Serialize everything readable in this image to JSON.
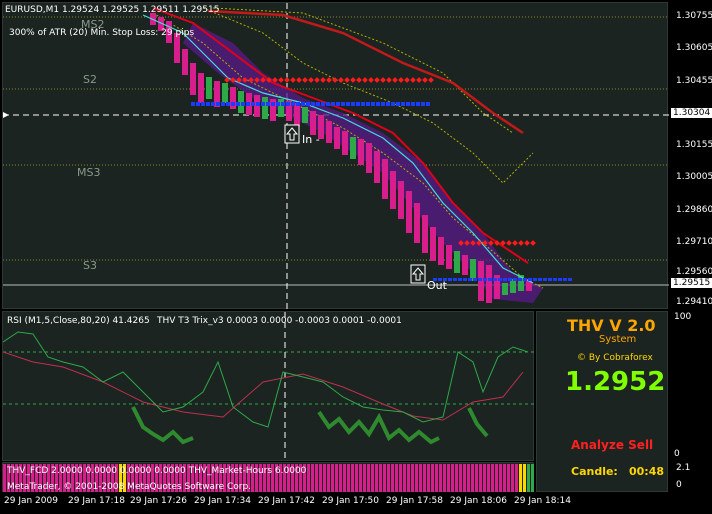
{
  "symbol_header": "EURUSD,M1  1.29524 1.29525 1.29511 1.29515",
  "atr_info": "300% of ATR (20)    Min. Stop Loss:   29 pips",
  "levels": {
    "ms2": "MS2",
    "s2": "S2",
    "ms3": "MS3",
    "s3": "S3"
  },
  "signals": {
    "in": "In -",
    "out": "Out"
  },
  "price_axis": [
    "1.30755",
    "1.30605",
    "1.30455",
    "1.30304",
    "1.30155",
    "1.30005",
    "1.29860",
    "1.29710",
    "1.29560",
    "1.29515",
    "1.29410"
  ],
  "current_price_label": "1.29515",
  "crosshair_price_label": "1.30304",
  "indicator_header": "RSI (M1,5,Close,80,20) 41.4265",
  "trix_header": "THV  T3 Trix_v3   0.0003 0.0000 -0.0003 0.0001 -0.0001",
  "indicator_axis": [
    "100",
    "0"
  ],
  "bar_header": "THV_FCD 2.0000  0.0000 0.0000 0.0000  THV_Market-Hours 6.0000",
  "copyright": "MetaTrader, © 2001-2008 MetaQuotes Software Corp.",
  "bar_axis": [
    "2.1",
    "0"
  ],
  "system": {
    "title": "THV V 2.0",
    "subtitle": "System",
    "by": "© By Cobraforex",
    "price": "1.2952",
    "signal": "Analyze Sell",
    "candle_label": "Candle:",
    "candle_time": "00:48"
  },
  "time_axis": [
    "29 Jan 2009",
    "29 Jan 17:18",
    "29 Jan 17:26",
    "29 Jan 17:34",
    "29 Jan 17:42",
    "29 Jan 17:50",
    "29 Jan 17:58",
    "29 Jan 18:06",
    "29 Jan 18:14"
  ],
  "colors": {
    "background": "#1b2420",
    "bear_candle": "#d81e8c",
    "bull_candle": "#2fa84a",
    "red_ma": "#e0001a",
    "cyan_ma": "#3fe0e0",
    "envelope": "#b0b000",
    "purple_cloud": "#5a1a8a",
    "red_dots": "#ff1a1a",
    "blue_dots": "#1a3cff",
    "title_orange": "#ffa500",
    "price_green": "#7fff00",
    "sell_red": "#ff2020",
    "candle_yellow": "#ffd700"
  }
}
